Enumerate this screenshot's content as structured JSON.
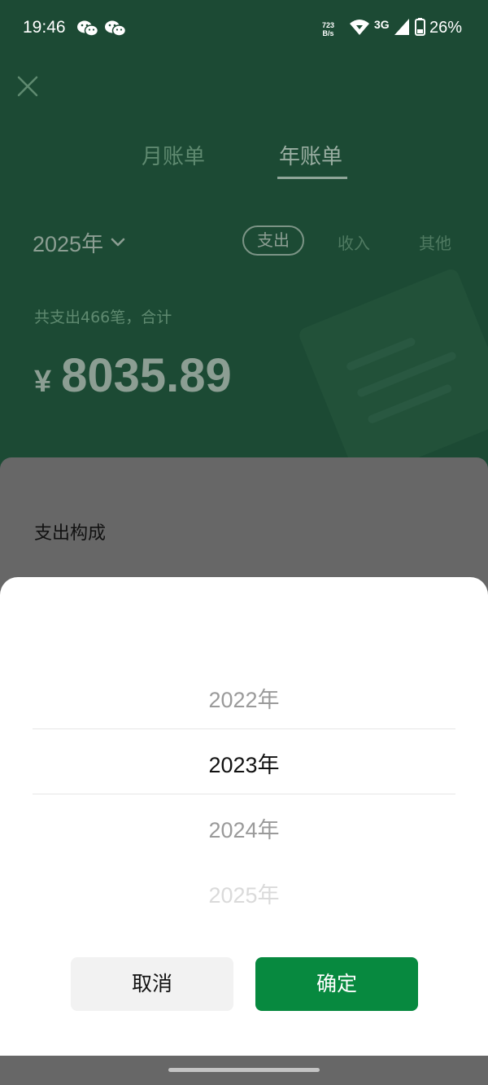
{
  "status_bar": {
    "time": "19:46",
    "icons": [
      "wechat-icon",
      "wechat-icon",
      "wifi-icon",
      "signal-icon",
      "battery-icon"
    ],
    "net_speed_value": "723",
    "net_speed_unit": "B/s",
    "network": "3G",
    "battery": "26%"
  },
  "header": {
    "close_icon": "close-icon",
    "tabs": [
      {
        "label": "月账单",
        "active": false
      },
      {
        "label": "年账单",
        "active": true
      }
    ],
    "year_select": "2025年",
    "year_select_icon": "chevron-down-icon",
    "filters": [
      {
        "label": "支出",
        "active": true
      },
      {
        "label": "收入",
        "active": false
      },
      {
        "label": "其他",
        "active": false
      }
    ],
    "count_text": "共支出466笔，合计",
    "currency": "¥",
    "total": "8035.89"
  },
  "section": {
    "title": "支出构成"
  },
  "picker": {
    "items": [
      "2022年",
      "2023年",
      "2024年",
      "2025年"
    ],
    "selected": "2023年",
    "cancel_label": "取消",
    "confirm_label": "确定"
  },
  "colors": {
    "header_bg": "#1c4a34",
    "confirm_button": "#07893f",
    "overlay_gray": "#676767"
  }
}
